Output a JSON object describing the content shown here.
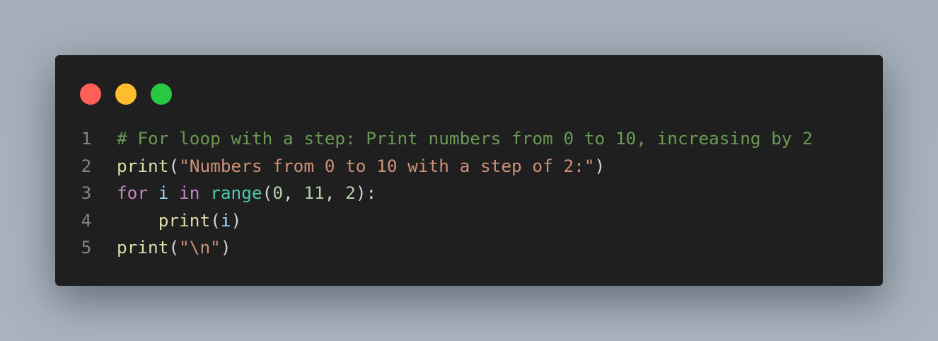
{
  "colors": {
    "close": "#ff5f57",
    "minimize": "#febc2e",
    "maximize": "#28c840",
    "comment": "#6a9955",
    "function": "#dcdcaa",
    "string": "#ce9178",
    "keyword": "#c586c0",
    "variable": "#9cdcfe",
    "builtin": "#4ec9b0",
    "number": "#b5cea8",
    "default": "#d4d4d4"
  },
  "window_controls": [
    "close-icon",
    "minimize-icon",
    "maximize-icon"
  ],
  "lines": [
    {
      "number": "1",
      "tokens": [
        {
          "text": "# For loop with a step: Print numbers from 0 to 10, increasing by 2",
          "type": "comment"
        }
      ]
    },
    {
      "number": "2",
      "tokens": [
        {
          "text": "print",
          "type": "function"
        },
        {
          "text": "(",
          "type": "default"
        },
        {
          "text": "\"Numbers from 0 to 10 with a step of 2:\"",
          "type": "string"
        },
        {
          "text": ")",
          "type": "default"
        }
      ]
    },
    {
      "number": "3",
      "tokens": [
        {
          "text": "for",
          "type": "keyword"
        },
        {
          "text": " ",
          "type": "default"
        },
        {
          "text": "i",
          "type": "variable"
        },
        {
          "text": " ",
          "type": "default"
        },
        {
          "text": "in",
          "type": "keyword"
        },
        {
          "text": " ",
          "type": "default"
        },
        {
          "text": "range",
          "type": "builtin"
        },
        {
          "text": "(",
          "type": "default"
        },
        {
          "text": "0",
          "type": "number"
        },
        {
          "text": ", ",
          "type": "default"
        },
        {
          "text": "11",
          "type": "number"
        },
        {
          "text": ", ",
          "type": "default"
        },
        {
          "text": "2",
          "type": "number"
        },
        {
          "text": "):",
          "type": "default"
        }
      ]
    },
    {
      "number": "4",
      "tokens": [
        {
          "text": "    ",
          "type": "default"
        },
        {
          "text": "print",
          "type": "function"
        },
        {
          "text": "(",
          "type": "default"
        },
        {
          "text": "i",
          "type": "variable"
        },
        {
          "text": ")",
          "type": "default"
        }
      ]
    },
    {
      "number": "5",
      "tokens": [
        {
          "text": "print",
          "type": "function"
        },
        {
          "text": "(",
          "type": "default"
        },
        {
          "text": "\"\\n\"",
          "type": "string"
        },
        {
          "text": ")",
          "type": "default"
        }
      ]
    }
  ]
}
